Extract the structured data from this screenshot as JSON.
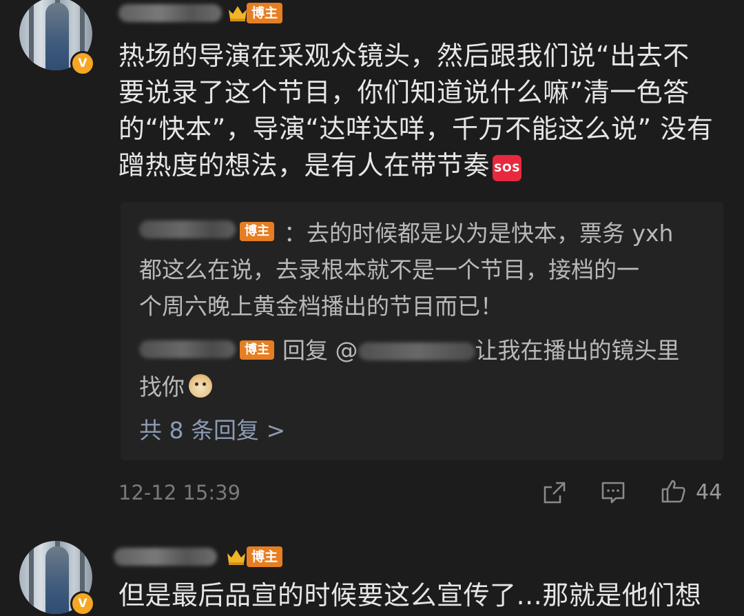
{
  "comment1": {
    "tag_label": "博主",
    "avatar_badge": "V",
    "lines": [
      "热场的导演在采观众镜头，然后跟我们说“出去不",
      "要说录了这个节目，你们知道说什么嘛”清一色答",
      "的“快本”，导演“达咩达咩，千万不能这么说” 没有",
      "蹭热度的想法，是有人在带节奏"
    ],
    "emoji_sos": "SOS",
    "reply1": {
      "tag_label": "博主",
      "lines": [
        "：去的时候都是以为是快本，票务 yxh",
        "都这么在说，去录根本就不是一个节目，接档的一",
        "个周六晚上黄金档播出的节目而已！"
      ]
    },
    "reply2": {
      "tag_label": "博主",
      "prefix": "回复 @",
      "line1_after": "让我在播出的镜头里",
      "line2": "找你"
    },
    "more_replies": "共 8 条回复 >",
    "timestamp": "12-12 15:39",
    "like_count": "44",
    "icons": [
      "share-icon",
      "comment-icon",
      "like-icon"
    ]
  },
  "comment2": {
    "tag_label": "博主",
    "avatar_badge": "V",
    "line1": "但是最后品宣的时候要这么宣传了...那就是他们想"
  },
  "colors": {
    "background": "#1c1c1c",
    "reply_background": "#232323",
    "tag": "#e67e22",
    "vip_badge": "#f5a623",
    "link": "#8c9bb4"
  }
}
